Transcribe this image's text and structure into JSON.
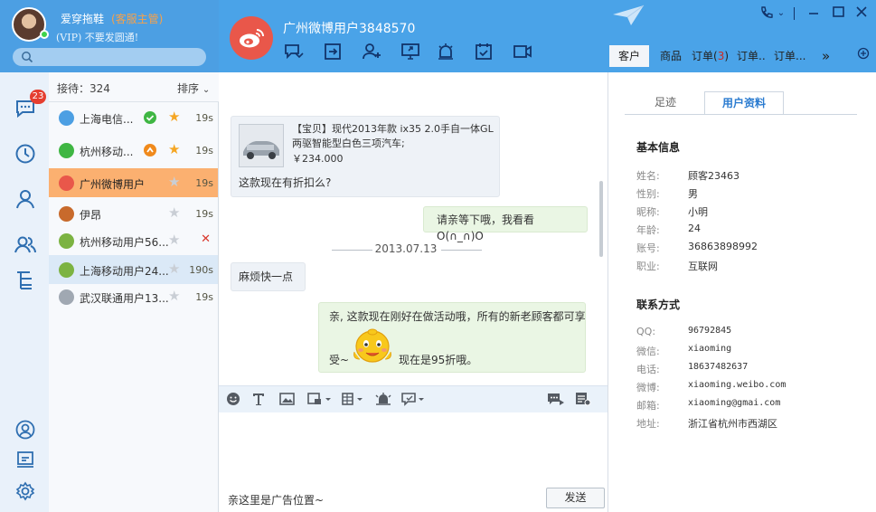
{
  "user": {
    "name": "爱穿拖鞋",
    "tag": "(客服主管)",
    "subtitle": "(VIP) 不要发圆通!"
  },
  "search": {
    "placeholder": ""
  },
  "nav": {
    "badge": "23"
  },
  "list": {
    "reception_label": "接待：324",
    "sort_label": "排序",
    "contacts": [
      {
        "name": "上海电信...",
        "time": "19s",
        "icon_color": "#4c9fe3",
        "status": "check",
        "status_color": "#3fb643",
        "star": "gold"
      },
      {
        "name": "杭州移动...",
        "time": "19s",
        "icon_color": "#3fb643",
        "status": "alert",
        "status_color": "#f08a1c",
        "star": "gold"
      },
      {
        "name": "广州微博用户",
        "time": "19s",
        "icon_color": "#e9574a",
        "status": "",
        "status_color": "",
        "star": "grey"
      },
      {
        "name": "伊昂",
        "time": "19s",
        "icon_color": "#c86a2c",
        "status": "",
        "status_color": "",
        "star": "grey"
      },
      {
        "name": "杭州移动用户56...",
        "time": "",
        "icon_color": "#7cb342",
        "status": "",
        "status_color": "",
        "star": "grey",
        "close": "✕"
      },
      {
        "name": "上海移动用户24...",
        "time": "190s",
        "icon_color": "#7cb342",
        "status": "",
        "status_color": "",
        "star": "grey"
      },
      {
        "name": "武汉联通用户13...",
        "time": "19s",
        "icon_color": "#a0a8b2",
        "status": "",
        "status_color": "",
        "star": "grey"
      }
    ]
  },
  "chat": {
    "title": "广州微博用户3848570",
    "product_title": "【宝贝】现代2013年款 ix35 2.0手自一体GL两驱智能型白色三项汽车;",
    "product_price": "￥234.000",
    "msg1": "这款现在有折扣么?",
    "msg2": "请亲等下哦，我看看O(∩_∩)O",
    "date": "2013.07.13",
    "msg3": "麻烦快一点",
    "msg4_line1": "亲, 这款现在刚好在做活动哦，所有的新老顾客都可享",
    "msg4_pre": "受~",
    "msg4_post": "现在是95折哦。",
    "ad_text": "亲这里是广告位置~",
    "send_label": "发送"
  },
  "right_tabs": {
    "customer": "客户",
    "goods": "商品",
    "order1_prefix": "订单(",
    "order1_count": "3",
    "order1_suffix": ")",
    "order2": "订单..",
    "order3": "订单...",
    "more": "»"
  },
  "panel": {
    "tab_footprint": "足迹",
    "tab_profile": "用户资料",
    "basic_title": "基本信息",
    "basic": [
      {
        "label": "姓名:",
        "value": "顾客23463"
      },
      {
        "label": "性别:",
        "value": "男"
      },
      {
        "label": "昵称:",
        "value": "小明"
      },
      {
        "label": "年龄:",
        "value": "24"
      },
      {
        "label": "账号:",
        "value": "36863898992"
      },
      {
        "label": "职业:",
        "value": "互联网"
      }
    ],
    "contact_title": "联系方式",
    "contact": [
      {
        "label": "QQ:",
        "value": "96792845"
      },
      {
        "label": "微信:",
        "value": "xiaoming"
      },
      {
        "label": "电话:",
        "value": "18637482637"
      },
      {
        "label": "微博:",
        "value": "xiaoming.weibo.com"
      },
      {
        "label": "邮箱:",
        "value": "xiaoming@gmai.com"
      },
      {
        "label": "地址:",
        "value": "浙江省杭州市西湖区"
      }
    ]
  }
}
